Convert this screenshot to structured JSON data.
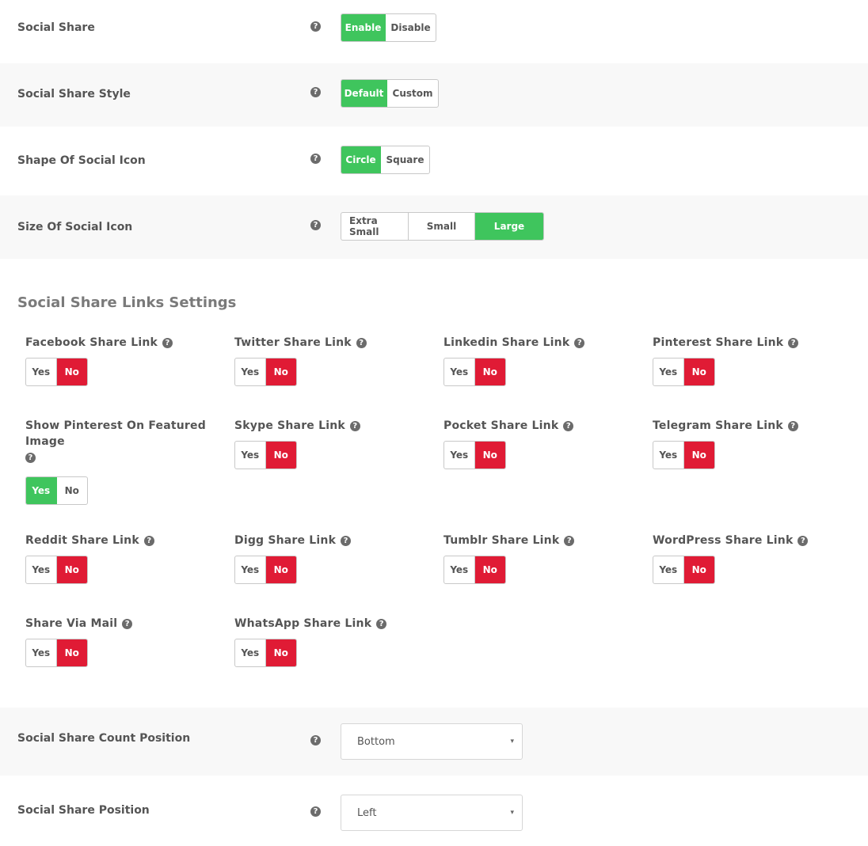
{
  "settings": {
    "social_share": {
      "label": "Social Share",
      "options": [
        "Enable",
        "Disable"
      ],
      "selected": "Enable"
    },
    "style": {
      "label": "Social Share Style",
      "options": [
        "Default",
        "Custom"
      ],
      "selected": "Default"
    },
    "shape": {
      "label": "Shape Of Social Icon",
      "options": [
        "Circle",
        "Square"
      ],
      "selected": "Circle"
    },
    "size": {
      "label": "Size Of Social Icon",
      "options": [
        "Extra Small",
        "Small",
        "Large"
      ],
      "selected": "Large"
    }
  },
  "links_section": {
    "title": "Social Share Links Settings",
    "yes_label": "Yes",
    "no_label": "No",
    "items": [
      {
        "label": "Facebook Share Link",
        "value": "No"
      },
      {
        "label": "Twitter Share Link",
        "value": "No"
      },
      {
        "label": "Linkedin Share Link",
        "value": "No"
      },
      {
        "label": "Pinterest Share Link",
        "value": "No"
      },
      {
        "label": "Show Pinterest On Featured Image",
        "value": "Yes"
      },
      {
        "label": "Skype Share Link",
        "value": "No"
      },
      {
        "label": "Pocket Share Link",
        "value": "No"
      },
      {
        "label": "Telegram Share Link",
        "value": "No"
      },
      {
        "label": "Reddit Share Link",
        "value": "No"
      },
      {
        "label": "Digg Share Link",
        "value": "No"
      },
      {
        "label": "Tumblr Share Link",
        "value": "No"
      },
      {
        "label": "WordPress Share Link",
        "value": "No"
      },
      {
        "label": "Share Via Mail",
        "value": "No"
      },
      {
        "label": "WhatsApp Share Link",
        "value": "No"
      }
    ]
  },
  "count_position": {
    "label": "Social Share Count Position",
    "value": "Bottom"
  },
  "share_position": {
    "label": "Social Share Position",
    "value": "Left"
  },
  "help_icon": "?",
  "caret_icon": "▾",
  "colors": {
    "green": "#3fc55d",
    "red": "#e01b35",
    "alt_row": "#f8f8f8"
  }
}
